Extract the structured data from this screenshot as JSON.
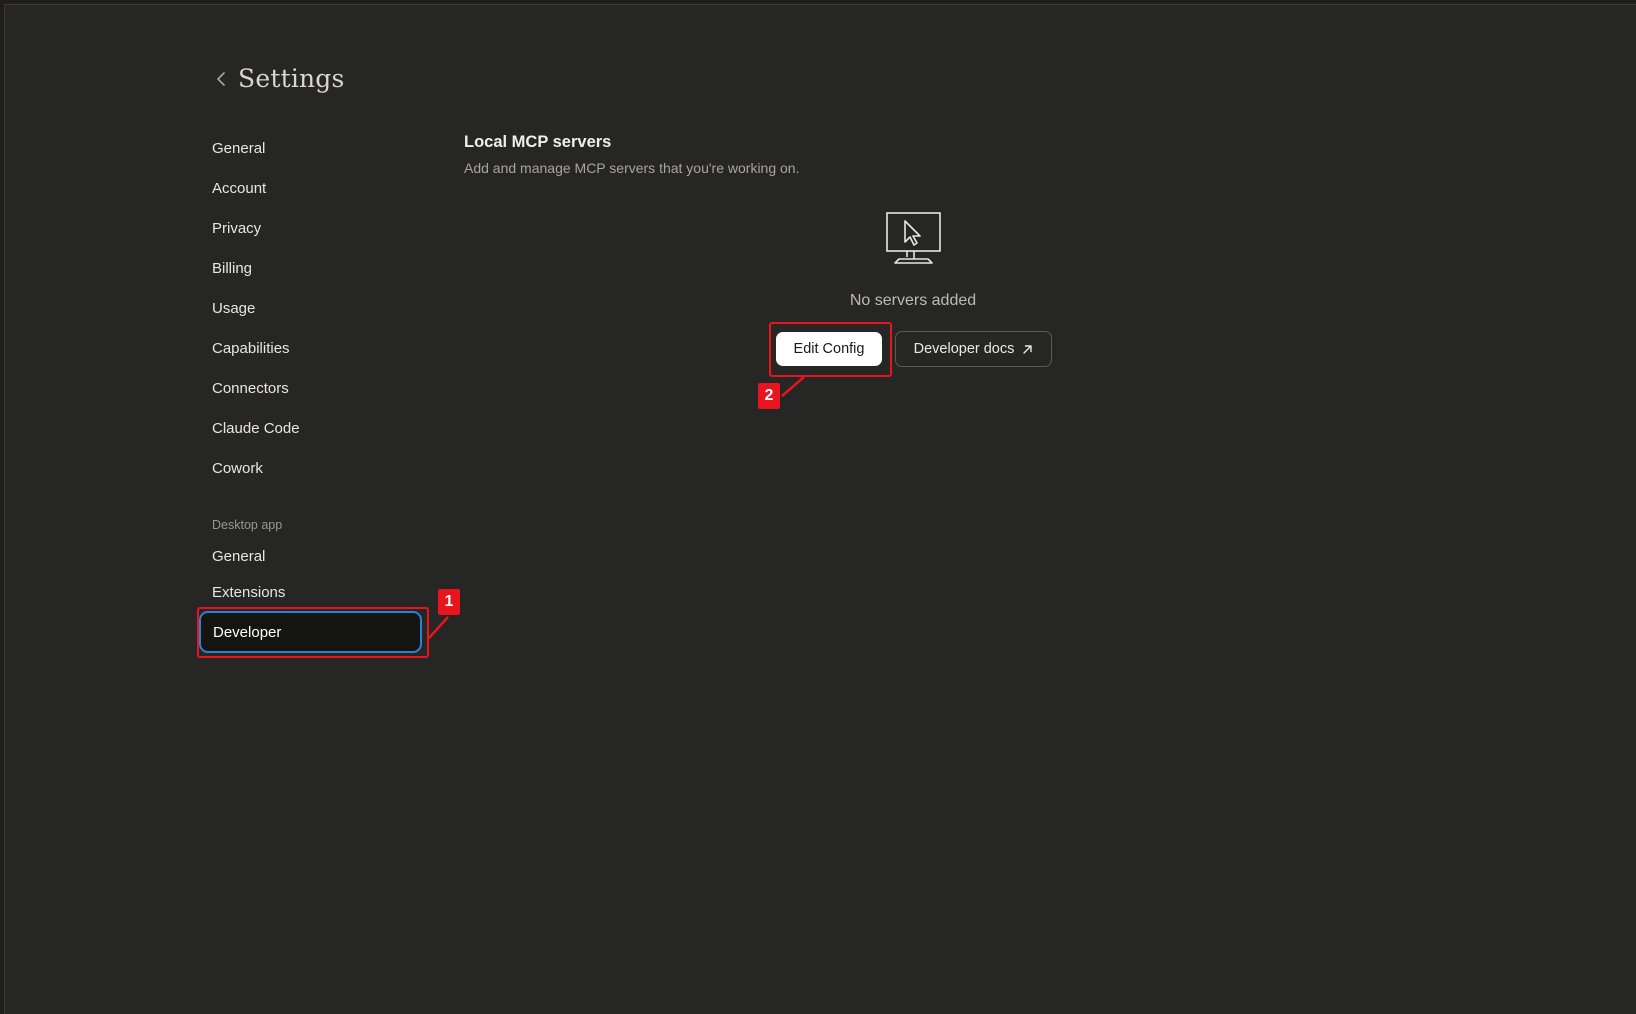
{
  "header": {
    "title": "Settings"
  },
  "sidebar": {
    "items": [
      {
        "label": "General"
      },
      {
        "label": "Account"
      },
      {
        "label": "Privacy"
      },
      {
        "label": "Billing"
      },
      {
        "label": "Usage"
      },
      {
        "label": "Capabilities"
      },
      {
        "label": "Connectors"
      },
      {
        "label": "Claude Code"
      },
      {
        "label": "Cowork"
      }
    ],
    "desktop_section": {
      "label": "Desktop app",
      "items": [
        {
          "label": "General"
        },
        {
          "label": "Extensions"
        },
        {
          "label": "Developer",
          "active": true
        }
      ]
    }
  },
  "main": {
    "title": "Local MCP servers",
    "subtitle": "Add and manage MCP servers that you're working on.",
    "empty_state": "No servers added",
    "edit_config_label": "Edit Config",
    "developer_docs_label": "Developer docs"
  },
  "annotations": {
    "first": "1",
    "second": "2",
    "color": "#e8141e"
  },
  "icons": {
    "back": "chevron-left-icon",
    "empty": "monitor-cursor-icon",
    "external": "arrow-up-right-icon"
  },
  "colors": {
    "background": "#262624",
    "active_outline": "#2f80d0",
    "annotation": "#e8141e"
  }
}
